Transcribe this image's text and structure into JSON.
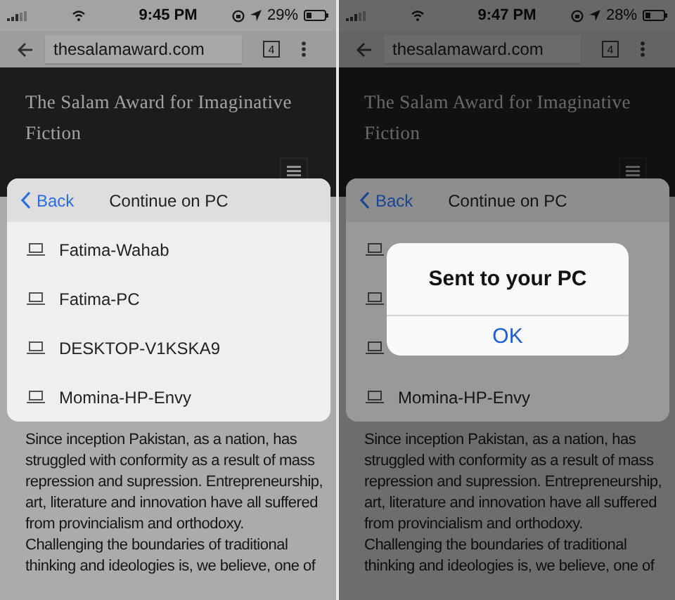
{
  "screens": [
    {
      "status_bar": {
        "time": "9:45 PM",
        "battery": "29%"
      },
      "address_bar": {
        "url": "thesalamaward.com",
        "tab_count": "4"
      },
      "site_title": "The Salam Award for Imaginative Fiction",
      "sheet": {
        "back": "Back",
        "title": "Continue on PC",
        "devices": [
          {
            "kind": "device",
            "name": "Fatima-Wahab"
          },
          {
            "kind": "device",
            "name": "Fatima-PC"
          },
          {
            "kind": "device",
            "name": "DESKTOP-V1KSKA9"
          },
          {
            "kind": "device",
            "name": "Momina-HP-Envy"
          }
        ]
      },
      "paragraph": "Since inception Pakistan, as a nation, has struggled with conformity as a result of mass repression and supression. Entrepreneurship, art, literature and innovation have all suffered from provincialism and orthodoxy. Challenging the boundaries of traditional thinking and ideologies is, we believe, one of"
    },
    {
      "status_bar": {
        "time": "9:47 PM",
        "battery": "28%"
      },
      "address_bar": {
        "url": "thesalamaward.com",
        "tab_count": "4"
      },
      "site_title": "The Salam Award for Imaginative Fiction",
      "sheet": {
        "back": "Back",
        "title": "Continue on PC",
        "devices": [
          {
            "kind": "covered"
          },
          {
            "kind": "covered"
          },
          {
            "kind": "covered"
          },
          {
            "kind": "device",
            "name": "Momina-HP-Envy"
          }
        ]
      },
      "paragraph": "Since inception Pakistan, as a nation, has struggled with conformity as a result of mass repression and supression. Entrepreneurship, art, literature and innovation have all suffered from provincialism and orthodoxy. Challenging the boundaries of traditional thinking and ideologies is, we believe, one of",
      "alert": {
        "message": "Sent to your PC",
        "button": "OK"
      }
    }
  ]
}
